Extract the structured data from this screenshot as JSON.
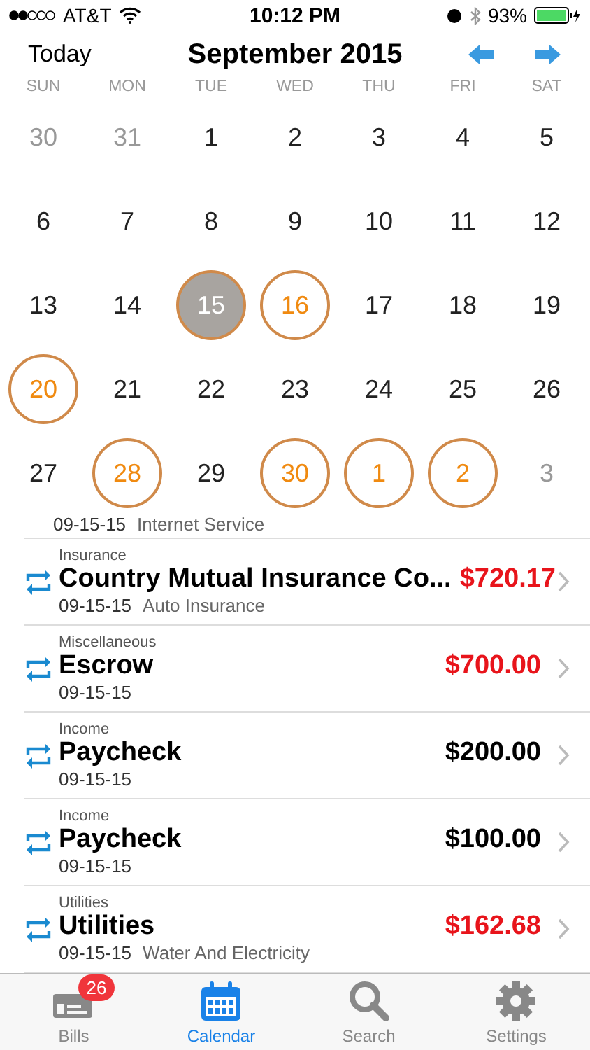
{
  "status_bar": {
    "carrier": "AT&T",
    "time": "10:12 PM",
    "battery": "93%"
  },
  "header": {
    "today": "Today",
    "title": "September 2015"
  },
  "weekdays": [
    "SUN",
    "MON",
    "TUE",
    "WED",
    "THU",
    "FRI",
    "SAT"
  ],
  "weeks": [
    [
      {
        "day": "30",
        "muted": true,
        "has_bills": false,
        "selected": false
      },
      {
        "day": "31",
        "muted": true,
        "has_bills": false,
        "selected": false
      },
      {
        "day": "1",
        "muted": false,
        "has_bills": false,
        "selected": false
      },
      {
        "day": "2",
        "muted": false,
        "has_bills": false,
        "selected": false
      },
      {
        "day": "3",
        "muted": false,
        "has_bills": false,
        "selected": false
      },
      {
        "day": "4",
        "muted": false,
        "has_bills": false,
        "selected": false
      },
      {
        "day": "5",
        "muted": false,
        "has_bills": false,
        "selected": false
      }
    ],
    [
      {
        "day": "6",
        "muted": false,
        "has_bills": false,
        "selected": false
      },
      {
        "day": "7",
        "muted": false,
        "has_bills": false,
        "selected": false
      },
      {
        "day": "8",
        "muted": false,
        "has_bills": false,
        "selected": false
      },
      {
        "day": "9",
        "muted": false,
        "has_bills": false,
        "selected": false
      },
      {
        "day": "10",
        "muted": false,
        "has_bills": false,
        "selected": false
      },
      {
        "day": "11",
        "muted": false,
        "has_bills": false,
        "selected": false
      },
      {
        "day": "12",
        "muted": false,
        "has_bills": false,
        "selected": false
      }
    ],
    [
      {
        "day": "13",
        "muted": false,
        "has_bills": false,
        "selected": false
      },
      {
        "day": "14",
        "muted": false,
        "has_bills": false,
        "selected": false
      },
      {
        "day": "15",
        "muted": false,
        "has_bills": true,
        "selected": true
      },
      {
        "day": "16",
        "muted": false,
        "has_bills": true,
        "selected": false
      },
      {
        "day": "17",
        "muted": false,
        "has_bills": false,
        "selected": false
      },
      {
        "day": "18",
        "muted": false,
        "has_bills": false,
        "selected": false
      },
      {
        "day": "19",
        "muted": false,
        "has_bills": false,
        "selected": false
      }
    ],
    [
      {
        "day": "20",
        "muted": false,
        "has_bills": true,
        "selected": false
      },
      {
        "day": "21",
        "muted": false,
        "has_bills": false,
        "selected": false
      },
      {
        "day": "22",
        "muted": false,
        "has_bills": false,
        "selected": false
      },
      {
        "day": "23",
        "muted": false,
        "has_bills": false,
        "selected": false
      },
      {
        "day": "24",
        "muted": false,
        "has_bills": false,
        "selected": false
      },
      {
        "day": "25",
        "muted": false,
        "has_bills": false,
        "selected": false
      },
      {
        "day": "26",
        "muted": false,
        "has_bills": false,
        "selected": false
      }
    ],
    [
      {
        "day": "27",
        "muted": false,
        "has_bills": false,
        "selected": false
      },
      {
        "day": "28",
        "muted": false,
        "has_bills": true,
        "selected": false
      },
      {
        "day": "29",
        "muted": false,
        "has_bills": false,
        "selected": false
      },
      {
        "day": "30",
        "muted": false,
        "has_bills": true,
        "selected": false
      },
      {
        "day": "1",
        "muted": false,
        "has_bills": true,
        "selected": false
      },
      {
        "day": "2",
        "muted": false,
        "has_bills": true,
        "selected": false
      },
      {
        "day": "3",
        "muted": true,
        "has_bills": false,
        "selected": false
      }
    ]
  ],
  "partial_bill": {
    "date": "09-15-15",
    "memo": "Internet Service"
  },
  "bills": [
    {
      "category": "Insurance",
      "name": "Country Mutual Insurance Co...",
      "amount": "$720.17",
      "color": "#e8141b",
      "date": "09-15-15",
      "memo": "Auto Insurance"
    },
    {
      "category": "Miscellaneous",
      "name": "Escrow",
      "amount": "$700.00",
      "color": "#e8141b",
      "date": "09-15-15"
    },
    {
      "category": "Income",
      "name": "Paycheck",
      "amount": "$200.00",
      "color": "#000000",
      "date": "09-15-15"
    },
    {
      "category": "Income",
      "name": "Paycheck",
      "amount": "$100.00",
      "color": "#000000",
      "date": "09-15-15"
    },
    {
      "category": "Utilities",
      "name": "Utilities",
      "amount": "$162.68",
      "color": "#e8141b",
      "date": "09-15-15",
      "memo": "Water And Electricity"
    }
  ],
  "tabs": [
    {
      "kind": "bills",
      "label": "Bills",
      "badge": "26",
      "selected": false
    },
    {
      "kind": "calendar",
      "label": "Calendar",
      "selected": true
    },
    {
      "kind": "search",
      "label": "Search",
      "selected": false
    },
    {
      "kind": "settings",
      "label": "Settings",
      "selected": false
    }
  ]
}
